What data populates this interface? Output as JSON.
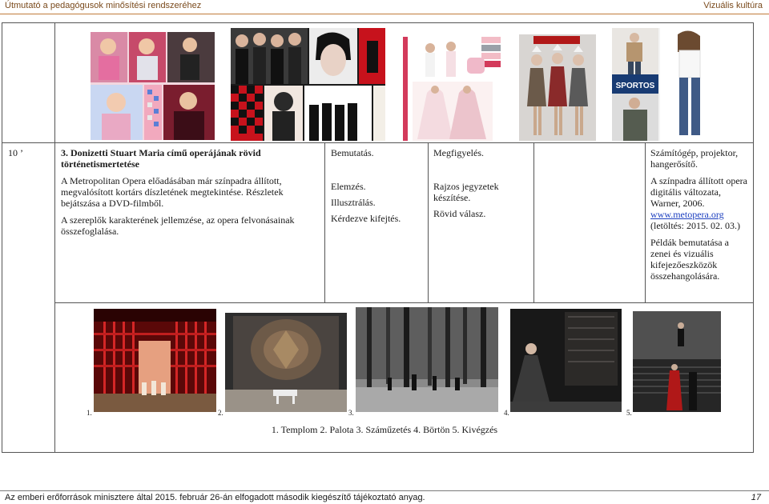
{
  "header": {
    "left": "Útmutató a pedagógusok minősítési rendszeréhez",
    "right": "Vizuális kultúra"
  },
  "row": {
    "time": "10 ’",
    "col_content": {
      "title": "3. Donizetti Stuart Maria című operájának rövid történetismertetése",
      "p1": "A Metropolitan Opera előadásában már színpadra állított, megvalósított kortárs díszletének megtekintése. Részletek bejátszása a DVD-filmből.",
      "p2": "A szereplők karakterének jellemzése, az opera felvonásainak összefoglalása."
    },
    "col_method": {
      "a": "Bemutatás.",
      "b": "Elemzés.",
      "c": "Illusztrálás.",
      "d": "Kérdezve kifejtés."
    },
    "col_activity": {
      "a": "Megfigyelés.",
      "b": "Rajzos jegyzetek készítése.",
      "c": "Rövid válasz."
    },
    "col_tools": {
      "a": "Számítógép, projektor, hangerősítő.",
      "b": "A színpadra állított opera digitális változata, Warner, 2006.",
      "link": "www.metopera.org",
      "c": "(letöltés: 2015. 02. 03.)",
      "d": "Példák bemutatása a zenei és vizuális kifejezőeszközök összehangolására."
    }
  },
  "top_images": [
    {
      "icon": "lolita-fashion-collage"
    },
    {
      "icon": "emo-fashion-collage"
    },
    {
      "icon": "fashion-collage-pink"
    },
    {
      "icon": "fashion-collage-dresses"
    },
    {
      "icon": "sportos-fashion-collage",
      "label": "SPORTOS"
    }
  ],
  "stage": {
    "numbers": [
      "1.",
      "2.",
      "3.",
      "4.",
      "5."
    ],
    "caption": "1. Templom 2. Palota 3. Száműzetés 4. Börtön 5. Kivégzés"
  },
  "footer": {
    "left": "Az emberi erőforrások minisztere által 2015. február 26-án elfogadott második kiegészítő tájékoztató anyag.",
    "page": "17"
  }
}
